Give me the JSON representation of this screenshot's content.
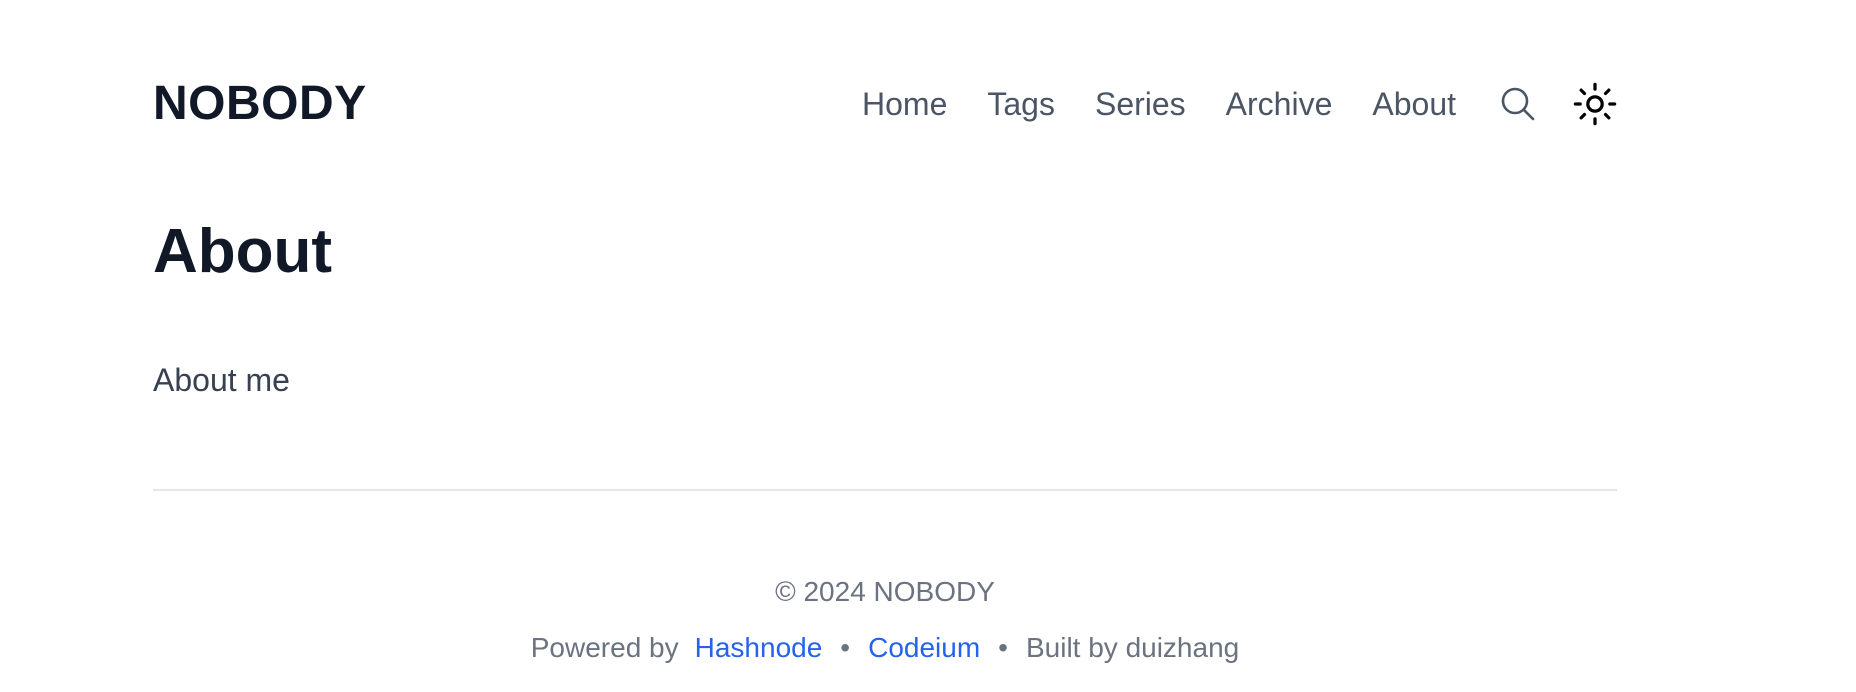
{
  "header": {
    "logo": "NOBODY",
    "nav": [
      {
        "label": "Home"
      },
      {
        "label": "Tags"
      },
      {
        "label": "Series"
      },
      {
        "label": "Archive"
      },
      {
        "label": "About"
      }
    ],
    "icons": {
      "search": "search-icon",
      "theme": "sun-icon"
    }
  },
  "main": {
    "title": "About",
    "body": "About me"
  },
  "footer": {
    "copyright": "© 2024 NOBODY",
    "powered_prefix": "Powered by",
    "links": [
      {
        "label": "Hashnode"
      },
      {
        "label": "Codeium"
      }
    ],
    "separator": "•",
    "built_by": "Built by duizhang"
  },
  "colors": {
    "heading": "#111827",
    "nav_text": "#4b5563",
    "body_text": "#374151",
    "muted": "#6b7280",
    "link": "#2563eb",
    "divider": "#e5e7eb"
  }
}
